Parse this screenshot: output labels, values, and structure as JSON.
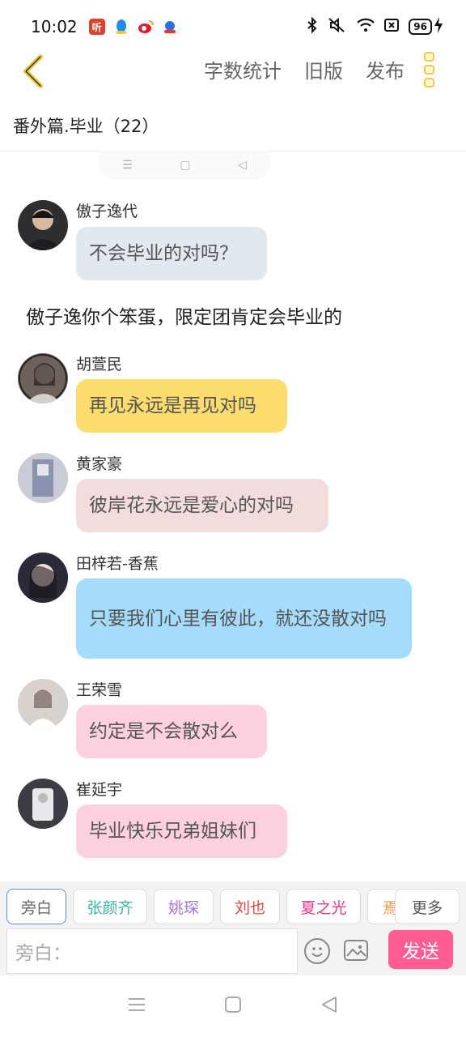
{
  "status_bar": {
    "time": "10:02",
    "apps": [
      {
        "label": "听",
        "color": "#e0402a"
      },
      {
        "label": "",
        "color": "#1f8fe6"
      },
      {
        "label": "",
        "color": "#e6162d"
      },
      {
        "label": "",
        "color": "#2b6fe0"
      }
    ],
    "battery": "96"
  },
  "nav": {
    "word_count": "字数统计",
    "old_version": "旧版",
    "publish": "发布"
  },
  "chapter_title": "番外篇.毕业（22）",
  "messages": [
    {
      "name": "傲子逸代",
      "text": "不会毕业的对吗？",
      "bubble_color": "#e2e8f0",
      "avatar_color": "#3a3a3a"
    },
    {
      "name": "胡萱民",
      "text": "再见永远是再见对吗",
      "bubble_color": "#fddc6f",
      "avatar_color": "#8a7a70"
    },
    {
      "name": "黄家豪",
      "text": "彼岸花永远是爱心的对吗",
      "bubble_color": "#f2dcdc",
      "avatar_color": "#9aa0b8"
    },
    {
      "name": "田梓若-香蕉",
      "text": "只要我们心里有彼此，就还没散对吗",
      "bubble_color": "#a5dcfb",
      "avatar_color": "#4a3a42"
    },
    {
      "name": "王荣雪",
      "text": "约定是不会散对么",
      "bubble_color": "#fdd0dd",
      "avatar_color": "#bdb5b0"
    },
    {
      "name": "崔延宇",
      "text": "毕业快乐兄弟姐妹们",
      "bubble_color": "#fdd0dd",
      "avatar_color": "#5a5a60"
    }
  ],
  "narration": "傲子逸你个笨蛋，限定团肯定会毕业的",
  "characters": [
    {
      "label": "旁白",
      "color": "#666666"
    },
    {
      "label": "张颜齐",
      "color": "#3bb6a0"
    },
    {
      "label": "姚琛",
      "color": "#a878d0"
    },
    {
      "label": "刘也",
      "color": "#e04848"
    },
    {
      "label": "夏之光",
      "color": "#e0388a"
    },
    {
      "label": "焉",
      "color": "#f09040"
    }
  ],
  "more_label": "更多",
  "input": {
    "placeholder": "旁白："
  },
  "send_label": "发送"
}
